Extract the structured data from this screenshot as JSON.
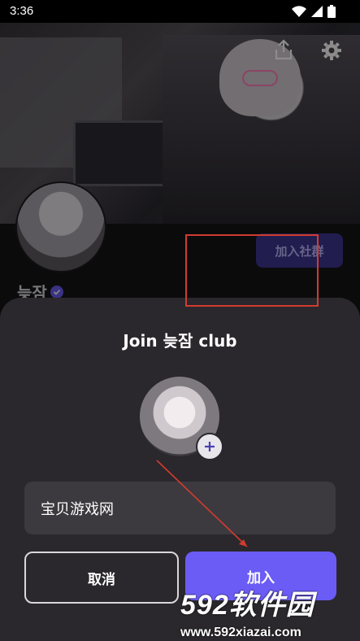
{
  "status_bar": {
    "time": "3:36"
  },
  "banner": {
    "icons": [
      "share-icon",
      "gear-icon"
    ]
  },
  "profile": {
    "name": "늦잠",
    "join_community_label": "加入社群"
  },
  "dialog": {
    "title": "Join 늦잠 club",
    "name_value": "宝贝游戏网",
    "cancel_label": "取消",
    "join_label": "加入"
  },
  "watermark": {
    "title": "592软件园",
    "url": "www.592xiazai.com"
  },
  "colors": {
    "accent": "#6b5cf5",
    "annotation": "#d23b30",
    "sheet_bg": "#2a282c"
  }
}
